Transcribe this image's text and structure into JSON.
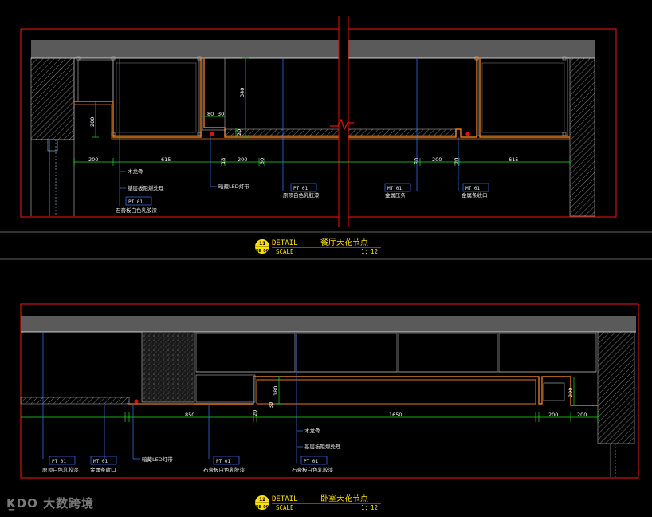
{
  "watermark": {
    "logo": "K̲DO",
    "text": "大数跨境"
  },
  "detail_top": {
    "number": "11",
    "sheet": "EB-09",
    "detail_label": "DETAIL",
    "title": "餐厅天花节点",
    "scale_label": "SCALE",
    "scale": "1：12",
    "dims": {
      "d200a": "200",
      "d615a": "615",
      "d200b": "200",
      "d200c": "200",
      "d615b": "615",
      "d200v": "200",
      "d340": "340",
      "d80": "80",
      "d30": "30",
      "d20": "20",
      "d18": "18",
      "d30b": "30",
      "d30c": "30",
      "d20b": "20"
    },
    "labels": {
      "wood": "木龙骨",
      "mold": "基层板阻燃处理",
      "gypsum": "石膏板白色乳胶漆",
      "led": "暗藏LED灯带",
      "paint": "原顶白色乳胶漆",
      "strip": "金属压条",
      "edge": "金属条收口"
    },
    "tags": {
      "pt1": "PT",
      "pt1n": "01",
      "pt2": "PT",
      "pt2n": "01",
      "mt1": "MT",
      "mt1n": "01",
      "mt2": "MT",
      "mt2n": "01"
    }
  },
  "detail_bottom": {
    "number": "12",
    "sheet": "EB-09",
    "detail_label": "DETAIL",
    "title": "卧室天花节点",
    "scale_label": "SCALE",
    "scale": "1：12",
    "dims": {
      "d850": "850",
      "d1650": "1650",
      "d200": "200",
      "d200b": "200",
      "d180": "180",
      "d30": "30",
      "d20": "20",
      "d200v": "200"
    },
    "labels": {
      "wood": "木龙骨",
      "mold": "基层板阻燃处理",
      "gypsum": "石膏板白色乳胶漆",
      "gypsum2": "石膏板白色乳胶漆",
      "led": "暗藏LED灯带",
      "paint": "原顶白色乳胶漆",
      "edge": "金属条收口"
    },
    "tags": {
      "pt1": "PT",
      "pt1n": "01",
      "mt1": "MT",
      "mt1n": "01",
      "pt2": "PT",
      "pt2n": "01",
      "pt3": "PT",
      "pt3n": "01"
    }
  }
}
